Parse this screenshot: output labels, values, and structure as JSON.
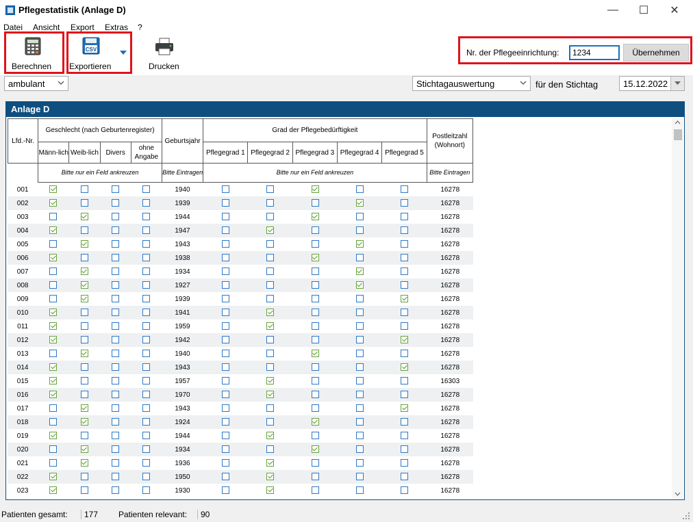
{
  "window": {
    "title": "Pflegestatistik (Anlage D)",
    "minimize": "—",
    "maximize": "☐",
    "close": "✕"
  },
  "menu": [
    "Datei",
    "Ansicht",
    "Export",
    "Extras",
    "?"
  ],
  "toolbar": {
    "calculate_label": "Berechnen",
    "export_label": "Exportieren",
    "export_icon_text": "CSV",
    "print_label": "Drucken",
    "facility_label": "Nr. der Pflegeeinrichtung:",
    "facility_value": "1234",
    "apply_label": "Übernehmen"
  },
  "filters": {
    "care_type": "ambulant",
    "evaluation": "Stichtagauswertung",
    "for_date_label": "für den Stichtag",
    "date": "15.12.2022"
  },
  "grid": {
    "title": "Anlage D",
    "headers": {
      "lfd_nr": "Lfd.-Nr.",
      "gender_group": "Geschlecht (nach Geburtenregister)",
      "male": "Männ-lich",
      "female": "Weib-lich",
      "divers": "Divers",
      "none": "ohne Angabe",
      "birth_year": "Geburtsjahr",
      "care_group": "Grad der Pflegebedürftigkeit",
      "care_levels": [
        "Pflegegrad 1",
        "Pflegegrad 2",
        "Pflegegrad 3",
        "Pflegegrad 4",
        "Pflegegrad 5"
      ],
      "postcode": "Postleitzahl (Wohnort)",
      "hint_one_field": "Bitte nur ein Feld ankreuzen",
      "hint_enter": "Bitte Eintragen"
    },
    "rows": [
      {
        "nr": "001",
        "gender": 0,
        "year": "1940",
        "grade": 3,
        "plz": "16278"
      },
      {
        "nr": "002",
        "gender": 0,
        "year": "1939",
        "grade": 4,
        "plz": "16278"
      },
      {
        "nr": "003",
        "gender": 1,
        "year": "1944",
        "grade": 3,
        "plz": "16278"
      },
      {
        "nr": "004",
        "gender": 0,
        "year": "1947",
        "grade": 2,
        "plz": "16278"
      },
      {
        "nr": "005",
        "gender": 1,
        "year": "1943",
        "grade": 4,
        "plz": "16278"
      },
      {
        "nr": "006",
        "gender": 0,
        "year": "1938",
        "grade": 3,
        "plz": "16278"
      },
      {
        "nr": "007",
        "gender": 1,
        "year": "1934",
        "grade": 4,
        "plz": "16278"
      },
      {
        "nr": "008",
        "gender": 1,
        "year": "1927",
        "grade": 4,
        "plz": "16278"
      },
      {
        "nr": "009",
        "gender": 1,
        "year": "1939",
        "grade": 5,
        "plz": "16278"
      },
      {
        "nr": "010",
        "gender": 0,
        "year": "1941",
        "grade": 2,
        "plz": "16278"
      },
      {
        "nr": "011",
        "gender": 0,
        "year": "1959",
        "grade": 2,
        "plz": "16278"
      },
      {
        "nr": "012",
        "gender": 0,
        "year": "1942",
        "grade": 5,
        "plz": "16278"
      },
      {
        "nr": "013",
        "gender": 1,
        "year": "1940",
        "grade": 3,
        "plz": "16278"
      },
      {
        "nr": "014",
        "gender": 0,
        "year": "1943",
        "grade": 5,
        "plz": "16278"
      },
      {
        "nr": "015",
        "gender": 0,
        "year": "1957",
        "grade": 2,
        "plz": "16303"
      },
      {
        "nr": "016",
        "gender": 0,
        "year": "1970",
        "grade": 2,
        "plz": "16278"
      },
      {
        "nr": "017",
        "gender": 1,
        "year": "1943",
        "grade": 5,
        "plz": "16278"
      },
      {
        "nr": "018",
        "gender": 1,
        "year": "1924",
        "grade": 3,
        "plz": "16278"
      },
      {
        "nr": "019",
        "gender": 0,
        "year": "1944",
        "grade": 2,
        "plz": "16278"
      },
      {
        "nr": "020",
        "gender": 1,
        "year": "1934",
        "grade": 3,
        "plz": "16278"
      },
      {
        "nr": "021",
        "gender": 1,
        "year": "1936",
        "grade": 2,
        "plz": "16278"
      },
      {
        "nr": "022",
        "gender": 0,
        "year": "1950",
        "grade": 2,
        "plz": "16278"
      },
      {
        "nr": "023",
        "gender": 0,
        "year": "1930",
        "grade": 2,
        "plz": "16278"
      }
    ]
  },
  "status": {
    "total_label": "Patienten gesamt:",
    "total_value": "177",
    "relevant_label": "Patienten relevant:",
    "relevant_value": "90"
  },
  "colors": {
    "accent": "#0e4f80",
    "highlight": "#e0121b",
    "check": "#67a23b",
    "checkbox": "#2b78c6"
  }
}
